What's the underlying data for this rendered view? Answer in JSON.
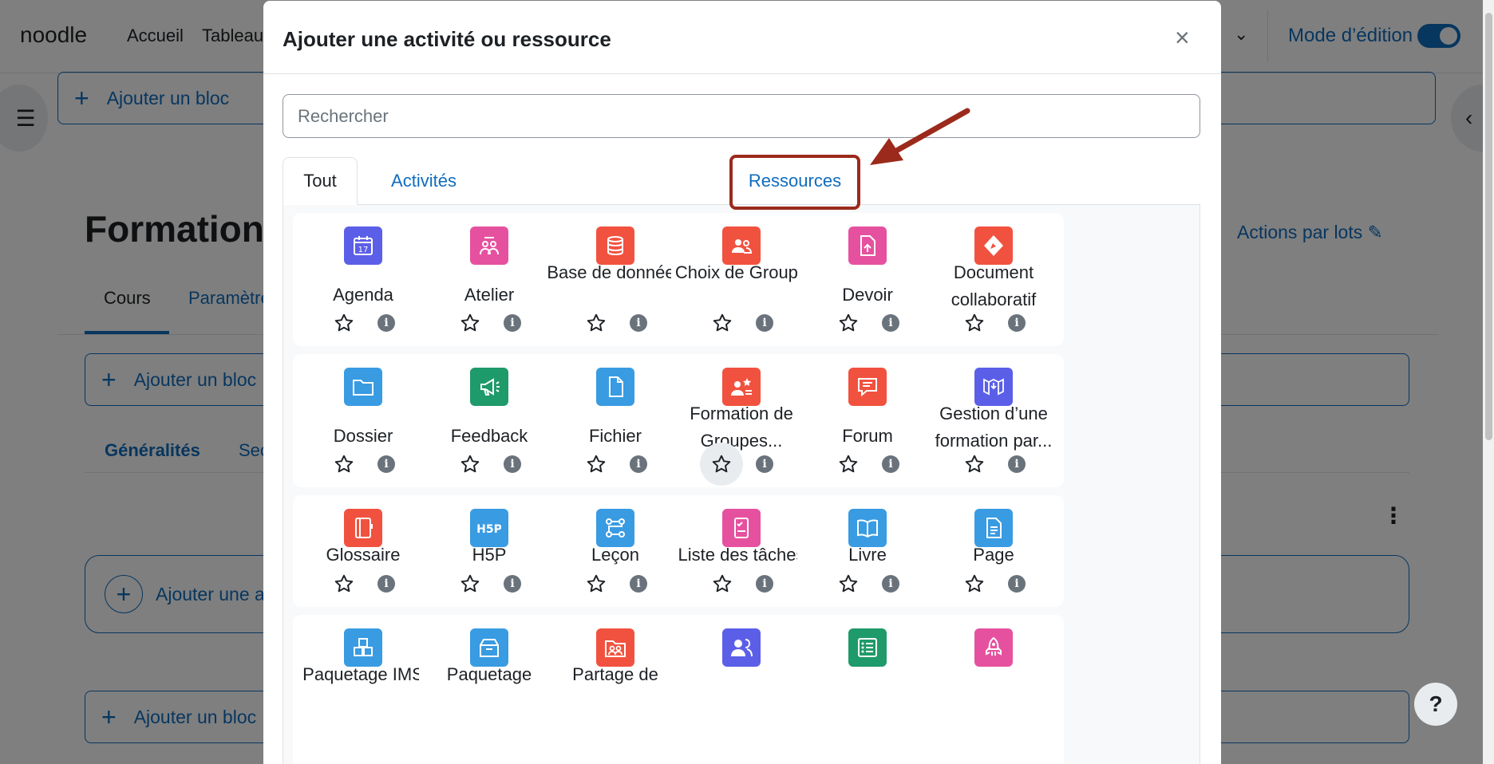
{
  "site": {
    "brand": "noodle",
    "nav": [
      "Accueil",
      "Tableau"
    ],
    "edit_mode_label": "Mode d’édition"
  },
  "background": {
    "add_block_label": "Ajouter un bloc",
    "course_title": "Formations",
    "bulk_actions": "Actions par lots",
    "tabs": [
      "Cours",
      "Paramètre"
    ],
    "sections": [
      "Généralités",
      "Sec"
    ],
    "add_activity_label": "Ajouter une ac",
    "help": "?"
  },
  "modal": {
    "title": "Ajouter une activité ou ressource",
    "close": "×",
    "search_placeholder": "Rechercher",
    "tabs": [
      "Tout",
      "Activités",
      "Ressources"
    ],
    "highlighted_tab": "Ressources"
  },
  "items": [
    {
      "name": "Agenda",
      "icon": "calendar-icon",
      "color": "#5b5fe8"
    },
    {
      "name": "Atelier",
      "icon": "workshop-icon",
      "color": "#e6519f"
    },
    {
      "name": "Base de données",
      "icon": "database-icon",
      "color": "#f1523f"
    },
    {
      "name": "Choix de Groupe",
      "icon": "group-choice-icon",
      "color": "#f1523f"
    },
    {
      "name": "Devoir",
      "icon": "assignment-icon",
      "color": "#e6519f"
    },
    {
      "name": "Document collaboratif",
      "icon": "collaborative-document-icon",
      "color": "#f1523f"
    },
    {
      "name": "Dossier",
      "icon": "folder-icon",
      "color": "#399be2"
    },
    {
      "name": "Feedback",
      "icon": "megaphone-icon",
      "color": "#1f9a6a"
    },
    {
      "name": "Fichier",
      "icon": "file-icon",
      "color": "#399be2"
    },
    {
      "name": "Formation de Groupes...",
      "icon": "group-formation-icon",
      "color": "#f1523f"
    },
    {
      "name": "Forum",
      "icon": "forum-icon",
      "color": "#f1523f"
    },
    {
      "name": "Gestion d’une formation par...",
      "icon": "training-management-icon",
      "color": "#5b5fe8"
    },
    {
      "name": "Glossaire",
      "icon": "glossary-icon",
      "color": "#f1523f"
    },
    {
      "name": "H5P",
      "icon": "h5p-icon",
      "color": "#399be2"
    },
    {
      "name": "Leçon",
      "icon": "lesson-icon",
      "color": "#399be2"
    },
    {
      "name": "Liste des tâches",
      "icon": "checklist-icon",
      "color": "#e6519f"
    },
    {
      "name": "Livre",
      "icon": "book-icon",
      "color": "#399be2"
    },
    {
      "name": "Page",
      "icon": "page-icon",
      "color": "#399be2"
    },
    {
      "name": "Paquetage IMS",
      "icon": "ims-package-icon",
      "color": "#399be2"
    },
    {
      "name": "Paquetage",
      "icon": "package-icon",
      "color": "#399be2"
    },
    {
      "name": "Partage de",
      "icon": "sharing-icon",
      "color": "#f1523f"
    },
    {
      "name": "",
      "icon": "users-icon",
      "color": "#5b5fe8"
    },
    {
      "name": "",
      "icon": "list-icon",
      "color": "#1f9a6a"
    },
    {
      "name": "",
      "icon": "rocket-icon",
      "color": "#e6519f"
    }
  ]
}
